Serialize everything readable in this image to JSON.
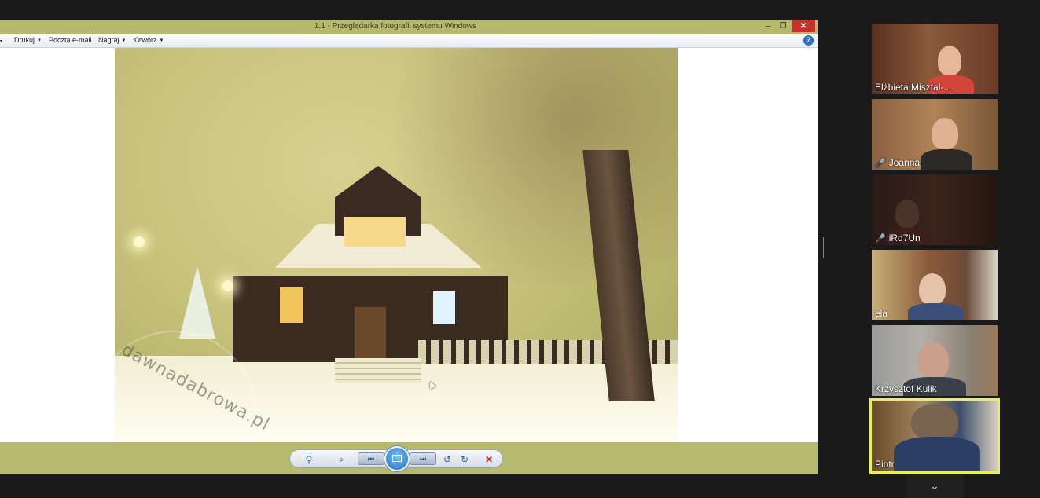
{
  "viewer": {
    "title": "1.1 - Przeglądarka fotografii systemu Windows",
    "controls": {
      "minimize": "–",
      "maximize": "❐",
      "close": "✕"
    },
    "menu": [
      {
        "label": "Drukuj"
      },
      {
        "label": "Poczta e-mail"
      },
      {
        "label": "Nagraj"
      },
      {
        "label": "Otwórz"
      }
    ],
    "help": "?",
    "photo": {
      "watermark": "dawnadabrowa.pl"
    },
    "toolbar": {
      "zoom": "⚲",
      "fit": "⌖",
      "prev": "⏮",
      "next": "⏭",
      "rotate_left": "↺",
      "rotate_right": "↻",
      "delete": "✕"
    }
  },
  "participants": [
    {
      "name": "Elżbieta Misztal-...",
      "muted": false
    },
    {
      "name": "Joanna",
      "muted": true
    },
    {
      "name": "iRd7Un",
      "muted": true
    },
    {
      "name": "ela",
      "muted": false
    },
    {
      "name": "Krzysztof Kulik",
      "muted": false
    },
    {
      "name": "Piotr",
      "muted": false,
      "active": true
    }
  ],
  "gallery": {
    "more": "⌄"
  },
  "colors": {
    "active_speaker": "#e9ef5a",
    "titlebar": "#b6b96a",
    "mute": "#e23a2e"
  }
}
